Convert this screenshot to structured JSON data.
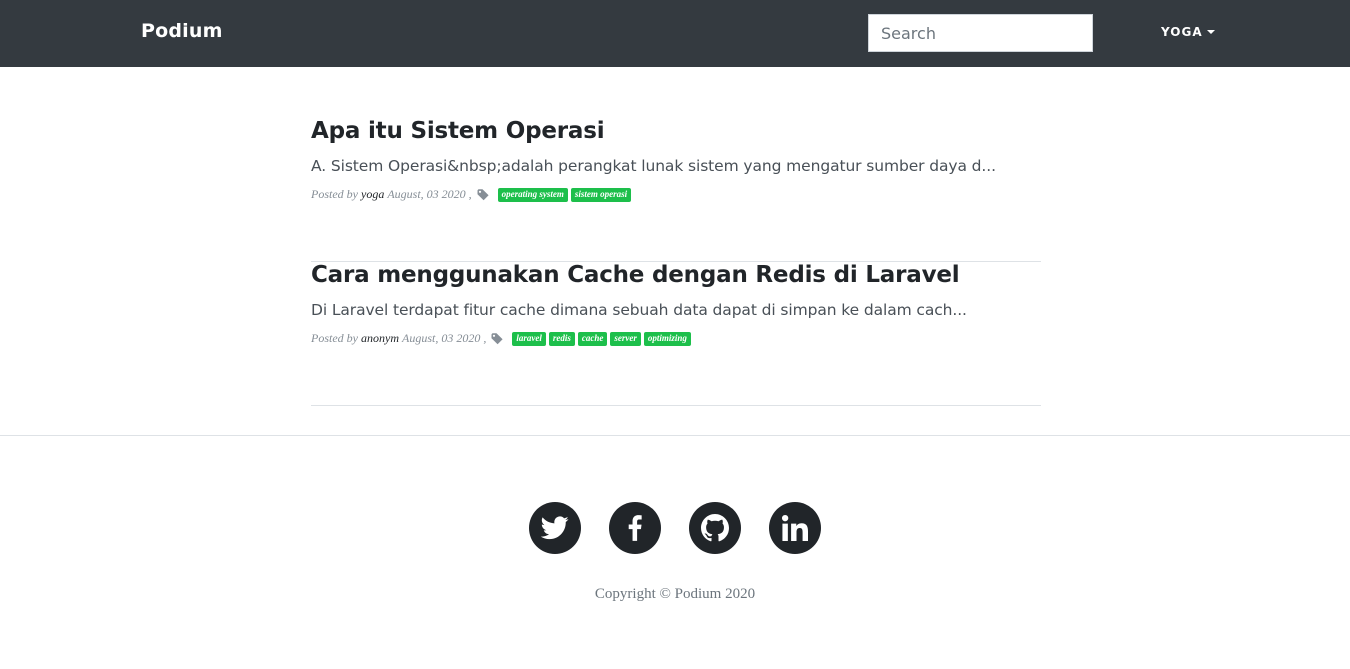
{
  "navbar": {
    "brand": "Podium",
    "search": {
      "placeholder": "Search",
      "value": ""
    },
    "user_menu": {
      "label": "YOGA"
    }
  },
  "posts": [
    {
      "title": "Apa itu Sistem Operasi",
      "excerpt": "A. Sistem Operasi&nbsp;adalah perangkat lunak sistem yang mengatur sumber daya d...",
      "posted_by_label": "Posted by",
      "author": "yoga",
      "date": "August, 03 2020 ,",
      "tags": [
        "operating system",
        "sistem operasi"
      ]
    },
    {
      "title": "Cara menggunakan Cache dengan Redis di Laravel",
      "excerpt": "Di Laravel terdapat fitur cache dimana sebuah data dapat di simpan ke dalam cach...",
      "posted_by_label": "Posted by",
      "author": "anonym",
      "date": "August, 03 2020 ,",
      "tags": [
        "laravel",
        "redis",
        "cache",
        "server",
        "optimizing"
      ]
    }
  ],
  "footer": {
    "social": [
      {
        "icon": "twitter-icon"
      },
      {
        "icon": "facebook-icon"
      },
      {
        "icon": "github-icon"
      },
      {
        "icon": "linkedin-icon"
      }
    ],
    "copyright": "Copyright © Podium 2020"
  },
  "colors": {
    "navbar_bg": "#343a40",
    "tag_bg": "#1dbf4b",
    "social_bg": "#212529"
  }
}
